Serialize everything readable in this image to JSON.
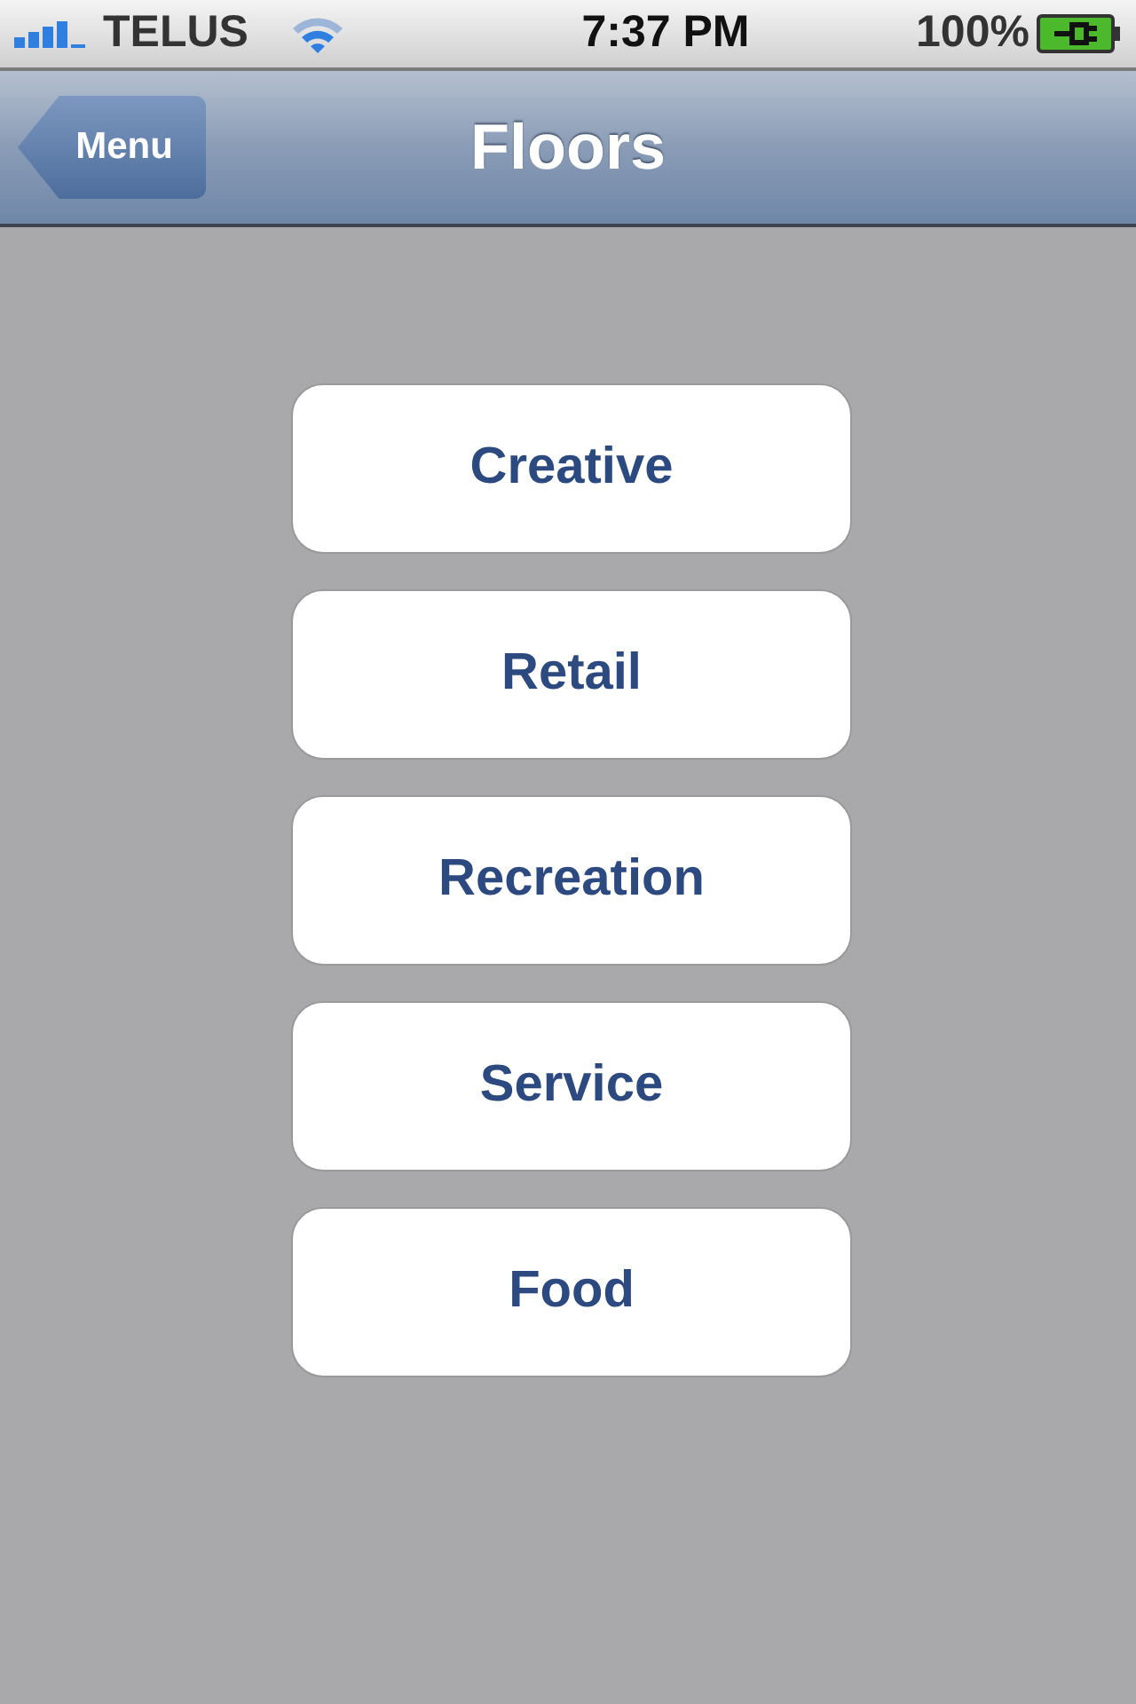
{
  "status_bar": {
    "carrier": "TELUS",
    "time": "7:37 PM",
    "battery": "100%"
  },
  "nav_bar": {
    "back_button": "Menu",
    "title": "Floors"
  },
  "floors": [
    {
      "label": "Creative"
    },
    {
      "label": "Retail"
    },
    {
      "label": "Recreation"
    },
    {
      "label": "Service"
    },
    {
      "label": "Food"
    }
  ]
}
